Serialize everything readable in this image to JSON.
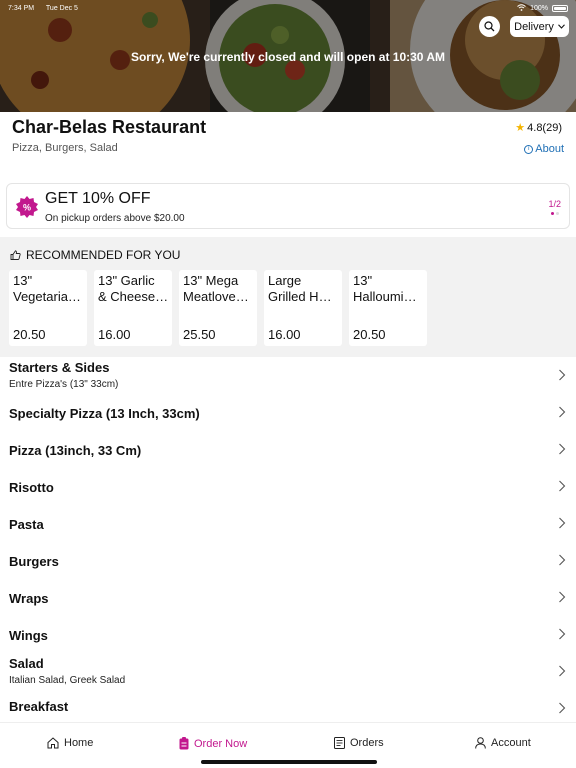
{
  "status_bar": {
    "time": "7:34 PM",
    "date": "Tue Dec 5",
    "battery": "100%"
  },
  "hero": {
    "closed_message": "Sorry, We're currently closed and will open at 10:30 AM",
    "delivery_label": "Delivery"
  },
  "restaurant": {
    "name": "Char-Belas Restaurant",
    "tags": "Pizza, Burgers, Salad",
    "rating": "4.8(29)",
    "about_label": "About"
  },
  "promo": {
    "title": "GET 10% OFF",
    "subtitle": "On pickup orders above $20.00",
    "pager": "1/2",
    "badge_glyph": "%"
  },
  "recommended": {
    "heading": "RECOMMENDED FOR YOU",
    "items": [
      {
        "line1": "13\"",
        "line2": "Vegetaria…",
        "price": "20.50"
      },
      {
        "line1": "13\" Garlic",
        "line2": "& Cheese…",
        "price": "16.00"
      },
      {
        "line1": "13\" Mega",
        "line2": "Meatlove…",
        "price": "25.50"
      },
      {
        "line1": "Large",
        "line2": "Grilled H…",
        "price": "16.00"
      },
      {
        "line1": "13\"",
        "line2": "Halloumi…",
        "price": "20.50"
      }
    ]
  },
  "categories": [
    {
      "name": "Starters & Sides",
      "sub": "Entre Pizza's (13\" 33cm)"
    },
    {
      "name": "Specialty Pizza (13 Inch, 33cm)",
      "sub": ""
    },
    {
      "name": "Pizza (13inch, 33 Cm)",
      "sub": ""
    },
    {
      "name": "Risotto",
      "sub": ""
    },
    {
      "name": "Pasta",
      "sub": ""
    },
    {
      "name": "Burgers",
      "sub": ""
    },
    {
      "name": "Wraps",
      "sub": ""
    },
    {
      "name": "Wings",
      "sub": ""
    },
    {
      "name": "Salad",
      "sub": "Italian Salad, Greek Salad"
    },
    {
      "name": "Breakfast",
      "sub": ""
    }
  ],
  "nav": {
    "home": "Home",
    "order_now": "Order Now",
    "orders": "Orders",
    "account": "Account"
  },
  "colors": {
    "accent": "#c2188e",
    "link": "#1f6fb5",
    "star": "#f4b400"
  }
}
